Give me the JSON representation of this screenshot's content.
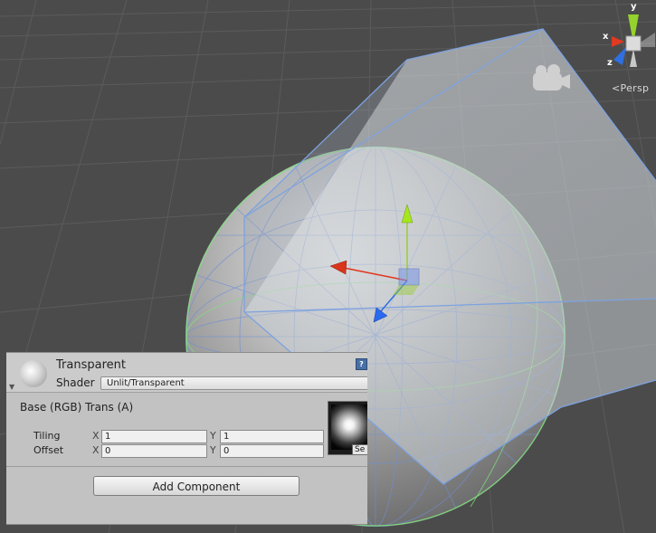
{
  "scene": {
    "camera_mode": "Persp",
    "axis_labels": {
      "x": "x",
      "y": "y",
      "z": "z"
    }
  },
  "inspector": {
    "material_name": "Transparent",
    "shader_label": "Shader",
    "shader_value": "Unlit/Transparent",
    "property_title": "Base (RGB) Trans (A)",
    "tiling": {
      "label": "Tiling",
      "x_axis": "X",
      "y_axis": "Y",
      "x": "1",
      "y": "1"
    },
    "offset": {
      "label": "Offset",
      "x_axis": "X",
      "y_axis": "Y",
      "x": "0",
      "y": "0"
    },
    "texture_select_label": "Se",
    "add_component_label": "Add Component"
  }
}
